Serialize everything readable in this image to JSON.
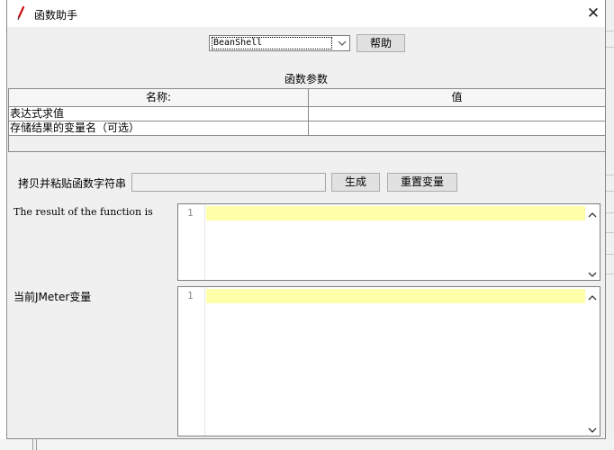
{
  "window": {
    "title": "函数助手",
    "close_glyph": "✕"
  },
  "function_select": {
    "value": "BeanShell"
  },
  "help_button": "帮助",
  "params_section": {
    "title": "函数参数",
    "columns": [
      "名称:",
      "值"
    ],
    "rows": [
      {
        "name": "表达式求值",
        "value": ""
      },
      {
        "name": "存储结果的变量名（可选）",
        "value": ""
      }
    ]
  },
  "copy_paste": {
    "label": "拷贝并粘贴函数字符串",
    "value": ""
  },
  "generate_button": "生成",
  "reset_button": "重置变量",
  "result_editor": {
    "label": "The result of the function is",
    "line_number": "1"
  },
  "vars_editor": {
    "label": "当前JMeter变量",
    "line_number": "1"
  },
  "colors": {
    "current_line_highlight": "#ffffaa",
    "title_icon": "#cc1111"
  },
  "icons": [
    "feather-icon",
    "close-icon",
    "chevron-down-icon",
    "scroll-up-icon",
    "scroll-down-icon"
  ]
}
